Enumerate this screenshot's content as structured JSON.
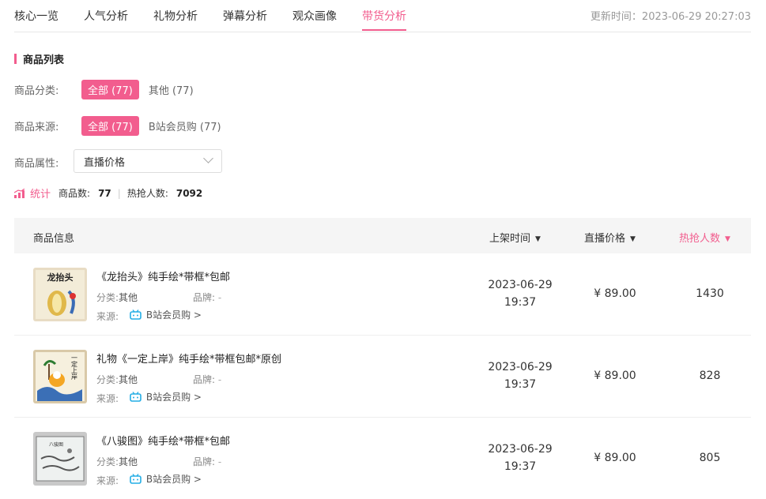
{
  "tabs": [
    {
      "label": "核心一览"
    },
    {
      "label": "人气分析"
    },
    {
      "label": "礼物分析"
    },
    {
      "label": "弹幕分析"
    },
    {
      "label": "观众画像"
    },
    {
      "label": "带货分析"
    }
  ],
  "update_time": "更新时间：2023-06-29 20:27:03",
  "section_title": "商品列表",
  "filters": {
    "category": {
      "label": "商品分类:",
      "all": "全部 (77)",
      "other": "其他 (77)"
    },
    "source": {
      "label": "商品来源:",
      "all": "全部 (77)",
      "other": "B站会员购 (77)"
    },
    "attribute": {
      "label": "商品属性:",
      "selected": "直播价格"
    }
  },
  "stats": {
    "title": "统计",
    "count_label": "商品数:",
    "count": "77",
    "hot_label": "热抢人数:",
    "hot": "7092"
  },
  "table": {
    "headers": {
      "info": "商品信息",
      "time": "上架时间",
      "price": "直播价格",
      "hot": "热抢人数"
    },
    "meta_labels": {
      "category": "分类:",
      "brand": "品牌:",
      "source": "来源:"
    },
    "rows": [
      {
        "title": "《龙抬头》纯手绘*带框*包邮",
        "category": "其他",
        "brand": "-",
        "source": "B站会员购 >",
        "date": "2023-06-29",
        "time": "19:37",
        "price": "¥ 89.00",
        "hot": "1430",
        "thumb_text": "龙抬头"
      },
      {
        "title": "礼物《一定上岸》纯手绘*带框包邮*原创",
        "category": "其他",
        "brand": "-",
        "source": "B站会员购 >",
        "date": "2023-06-29",
        "time": "19:37",
        "price": "¥ 89.00",
        "hot": "828",
        "thumb_text": "一定上岸"
      },
      {
        "title": "《八骏图》纯手绘*带框*包邮",
        "category": "其他",
        "brand": "-",
        "source": "B站会员购 >",
        "date": "2023-06-29",
        "time": "19:37",
        "price": "¥ 89.00",
        "hot": "805",
        "thumb_text": "八骏图"
      }
    ]
  },
  "colors": {
    "accent": "#f25d8e",
    "bilibili_blue": "#23ade5"
  }
}
